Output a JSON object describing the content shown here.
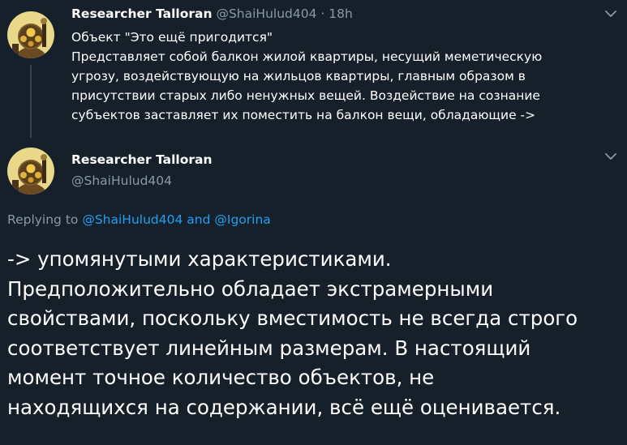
{
  "tweet1": {
    "author_name": "Researcher Talloran",
    "handle": "@ShaiHulud404",
    "separator": "·",
    "time": "18h",
    "text_lines": [
      "Объект \"Это ещё пригодится\"",
      "Представляет собой балкон жилой квартиры, несущий меметическую",
      "угрозу, воздействующую на жильцов квартиры, главным образом в",
      "присутствии старых либо ненужных вещей. Воздействие на сознание",
      "субъектов заставляет их поместить на балкон вещи, обладающие ->"
    ]
  },
  "tweet2": {
    "author_name": "Researcher Talloran",
    "handle": "@ShaiHulud404",
    "replying": {
      "prefix": "Replying to",
      "mention1": "@ShaiHulud404",
      "conjunction": "and",
      "mention2": "@Igorina"
    },
    "text_lines": [
      "-> упомянутыми характеристиками.",
      "Предположительно обладает экстрамерными",
      "свойствами, поскольку вместимость не всегда строго",
      "соответствует линейным размерам. В настоящий",
      "момент точное количество объектов, не",
      "находящихся на содержании, всё ещё оценивается."
    ]
  },
  "icons": {
    "avatar": "bioshock-big-daddy-avatar",
    "menu": "chevron-down-icon"
  },
  "colors": {
    "background": "#15202b",
    "text": "#ffffff",
    "muted": "#8899a6",
    "link": "#1da1f2",
    "thread_line": "#38444d"
  }
}
